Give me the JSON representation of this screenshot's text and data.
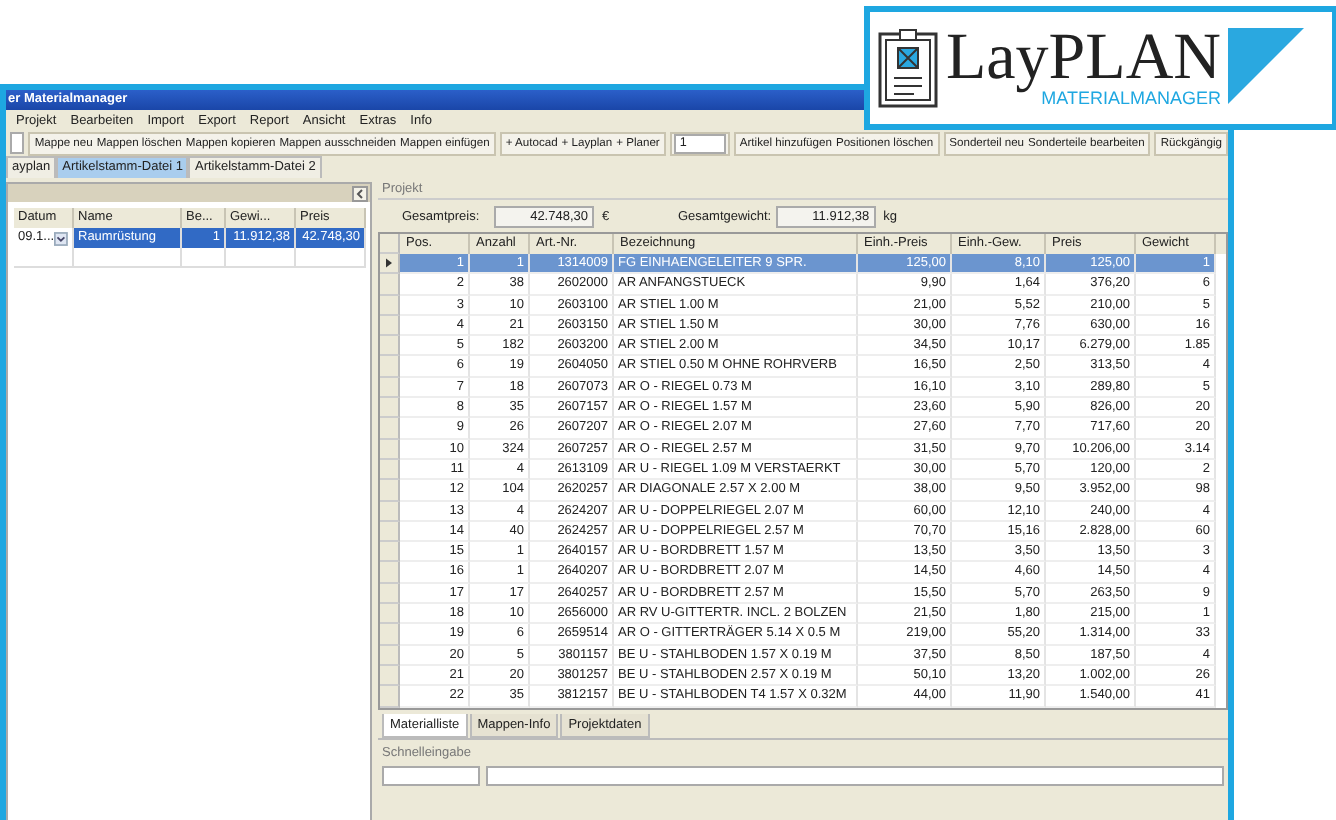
{
  "logo": {
    "title": "LayPLAN",
    "subtitle": "MATERIALMANAGER"
  },
  "window": {
    "title": "er Materialmanager"
  },
  "menu": [
    "Projekt",
    "Bearbeiten",
    "Import",
    "Export",
    "Report",
    "Ansicht",
    "Extras",
    "Info"
  ],
  "toolbar": [
    {
      "kind": "buttons",
      "items": [
        "Mappe neu",
        "Mappen löschen",
        "Mappen kopieren",
        "Mappen ausschneiden",
        "Mappen einfügen"
      ]
    },
    {
      "kind": "buttons",
      "items": [
        "+ Autocad",
        "+ Layplan",
        "+ Planer"
      ]
    },
    {
      "kind": "field",
      "value": "1"
    },
    {
      "kind": "buttons",
      "items": [
        "Artikel hinzufügen",
        "Positionen löschen"
      ]
    },
    {
      "kind": "buttons",
      "items": [
        "Sonderteil neu",
        "Sonderteile bearbeiten"
      ]
    },
    {
      "kind": "buttons",
      "items": [
        "Rückgängig"
      ]
    }
  ],
  "tabs": [
    {
      "label": "ayplan",
      "selected": false
    },
    {
      "label": "Artikelstamm-Datei 1",
      "selected": true
    },
    {
      "label": "Artikelstamm-Datei 2",
      "selected": false
    }
  ],
  "folders": {
    "columns": [
      "Datum",
      "Name",
      "Be...",
      "Gewi...",
      "Preis"
    ],
    "rows": [
      {
        "selected": true,
        "cells": [
          "09.1...",
          "Raumrüstung",
          "1",
          "11.912,38",
          "42.748,30"
        ]
      }
    ]
  },
  "project": {
    "label": "Projekt",
    "totals": [
      {
        "label": "Gesamtpreis:",
        "value": "42.748,30",
        "unit": "€"
      },
      {
        "label": "Gesamtgewicht:",
        "value": "11.912,38",
        "unit": "kg"
      }
    ],
    "columns": [
      "Pos.",
      "Anzahl",
      "Art.-Nr.",
      "Bezeichnung",
      "Einh.-Preis",
      "Einh.-Gew.",
      "Preis",
      "Gewicht"
    ],
    "rows": [
      {
        "selected": true,
        "cells": [
          "1",
          "1",
          "1314009",
          "FG EINHAENGELEITER 9 SPR.",
          "125,00",
          "8,10",
          "125,00",
          "1"
        ]
      },
      {
        "selected": false,
        "cells": [
          "2",
          "38",
          "2602000",
          "AR ANFANGSTUECK",
          "9,90",
          "1,64",
          "376,20",
          "6"
        ]
      },
      {
        "selected": false,
        "cells": [
          "3",
          "10",
          "2603100",
          "AR STIEL 1.00 M",
          "21,00",
          "5,52",
          "210,00",
          "5"
        ]
      },
      {
        "selected": false,
        "cells": [
          "4",
          "21",
          "2603150",
          "AR STIEL 1.50 M",
          "30,00",
          "7,76",
          "630,00",
          "16"
        ]
      },
      {
        "selected": false,
        "cells": [
          "5",
          "182",
          "2603200",
          "AR STIEL 2.00 M",
          "34,50",
          "10,17",
          "6.279,00",
          "1.85"
        ]
      },
      {
        "selected": false,
        "cells": [
          "6",
          "19",
          "2604050",
          "AR STIEL 0.50 M OHNE ROHRVERB",
          "16,50",
          "2,50",
          "313,50",
          "4"
        ]
      },
      {
        "selected": false,
        "cells": [
          "7",
          "18",
          "2607073",
          "AR O - RIEGEL 0.73 M",
          "16,10",
          "3,10",
          "289,80",
          "5"
        ]
      },
      {
        "selected": false,
        "cells": [
          "8",
          "35",
          "2607157",
          "AR O - RIEGEL 1.57 M",
          "23,60",
          "5,90",
          "826,00",
          "20"
        ]
      },
      {
        "selected": false,
        "cells": [
          "9",
          "26",
          "2607207",
          "AR O - RIEGEL 2.07 M",
          "27,60",
          "7,70",
          "717,60",
          "20"
        ]
      },
      {
        "selected": false,
        "cells": [
          "10",
          "324",
          "2607257",
          "AR O - RIEGEL 2.57 M",
          "31,50",
          "9,70",
          "10.206,00",
          "3.14"
        ]
      },
      {
        "selected": false,
        "cells": [
          "11",
          "4",
          "2613109",
          "AR U - RIEGEL 1.09 M VERSTAERKT",
          "30,00",
          "5,70",
          "120,00",
          "2"
        ]
      },
      {
        "selected": false,
        "cells": [
          "12",
          "104",
          "2620257",
          "AR DIAGONALE 2.57 X 2.00 M",
          "38,00",
          "9,50",
          "3.952,00",
          "98"
        ]
      },
      {
        "selected": false,
        "cells": [
          "13",
          "4",
          "2624207",
          "AR U - DOPPELRIEGEL 2.07 M",
          "60,00",
          "12,10",
          "240,00",
          "4"
        ]
      },
      {
        "selected": false,
        "cells": [
          "14",
          "40",
          "2624257",
          "AR U - DOPPELRIEGEL 2.57 M",
          "70,70",
          "15,16",
          "2.828,00",
          "60"
        ]
      },
      {
        "selected": false,
        "cells": [
          "15",
          "1",
          "2640157",
          "AR U - BORDBRETT 1.57 M",
          "13,50",
          "3,50",
          "13,50",
          "3"
        ]
      },
      {
        "selected": false,
        "cells": [
          "16",
          "1",
          "2640207",
          "AR U - BORDBRETT 2.07 M",
          "14,50",
          "4,60",
          "14,50",
          "4"
        ]
      },
      {
        "selected": false,
        "cells": [
          "17",
          "17",
          "2640257",
          "AR U - BORDBRETT 2.57 M",
          "15,50",
          "5,70",
          "263,50",
          "9"
        ]
      },
      {
        "selected": false,
        "cells": [
          "18",
          "10",
          "2656000",
          "AR RV U-GITTERTR. INCL. 2 BOLZEN",
          "21,50",
          "1,80",
          "215,00",
          "1"
        ]
      },
      {
        "selected": false,
        "cells": [
          "19",
          "6",
          "2659514",
          "AR O - GITTERTRÄGER 5.14 X 0.5 M",
          "219,00",
          "55,20",
          "1.314,00",
          "33"
        ]
      },
      {
        "selected": false,
        "cells": [
          "20",
          "5",
          "3801157",
          "BE U - STAHLBODEN 1.57 X 0.19 M",
          "37,50",
          "8,50",
          "187,50",
          "4"
        ]
      },
      {
        "selected": false,
        "cells": [
          "21",
          "20",
          "3801257",
          "BE U - STAHLBODEN 2.57 X 0.19 M",
          "50,10",
          "13,20",
          "1.002,00",
          "26"
        ]
      },
      {
        "selected": false,
        "cells": [
          "22",
          "35",
          "3812157",
          "BE U - STAHLBODEN T4 1.57 X 0.32M",
          "44,00",
          "11,90",
          "1.540,00",
          "41"
        ]
      }
    ]
  },
  "bottom_tabs": [
    {
      "label": "Materialliste",
      "selected": true
    },
    {
      "label": "Mappen-Info",
      "selected": false
    },
    {
      "label": "Projektdaten",
      "selected": false
    }
  ],
  "quick_entry": {
    "label": "Schnelleingabe"
  }
}
